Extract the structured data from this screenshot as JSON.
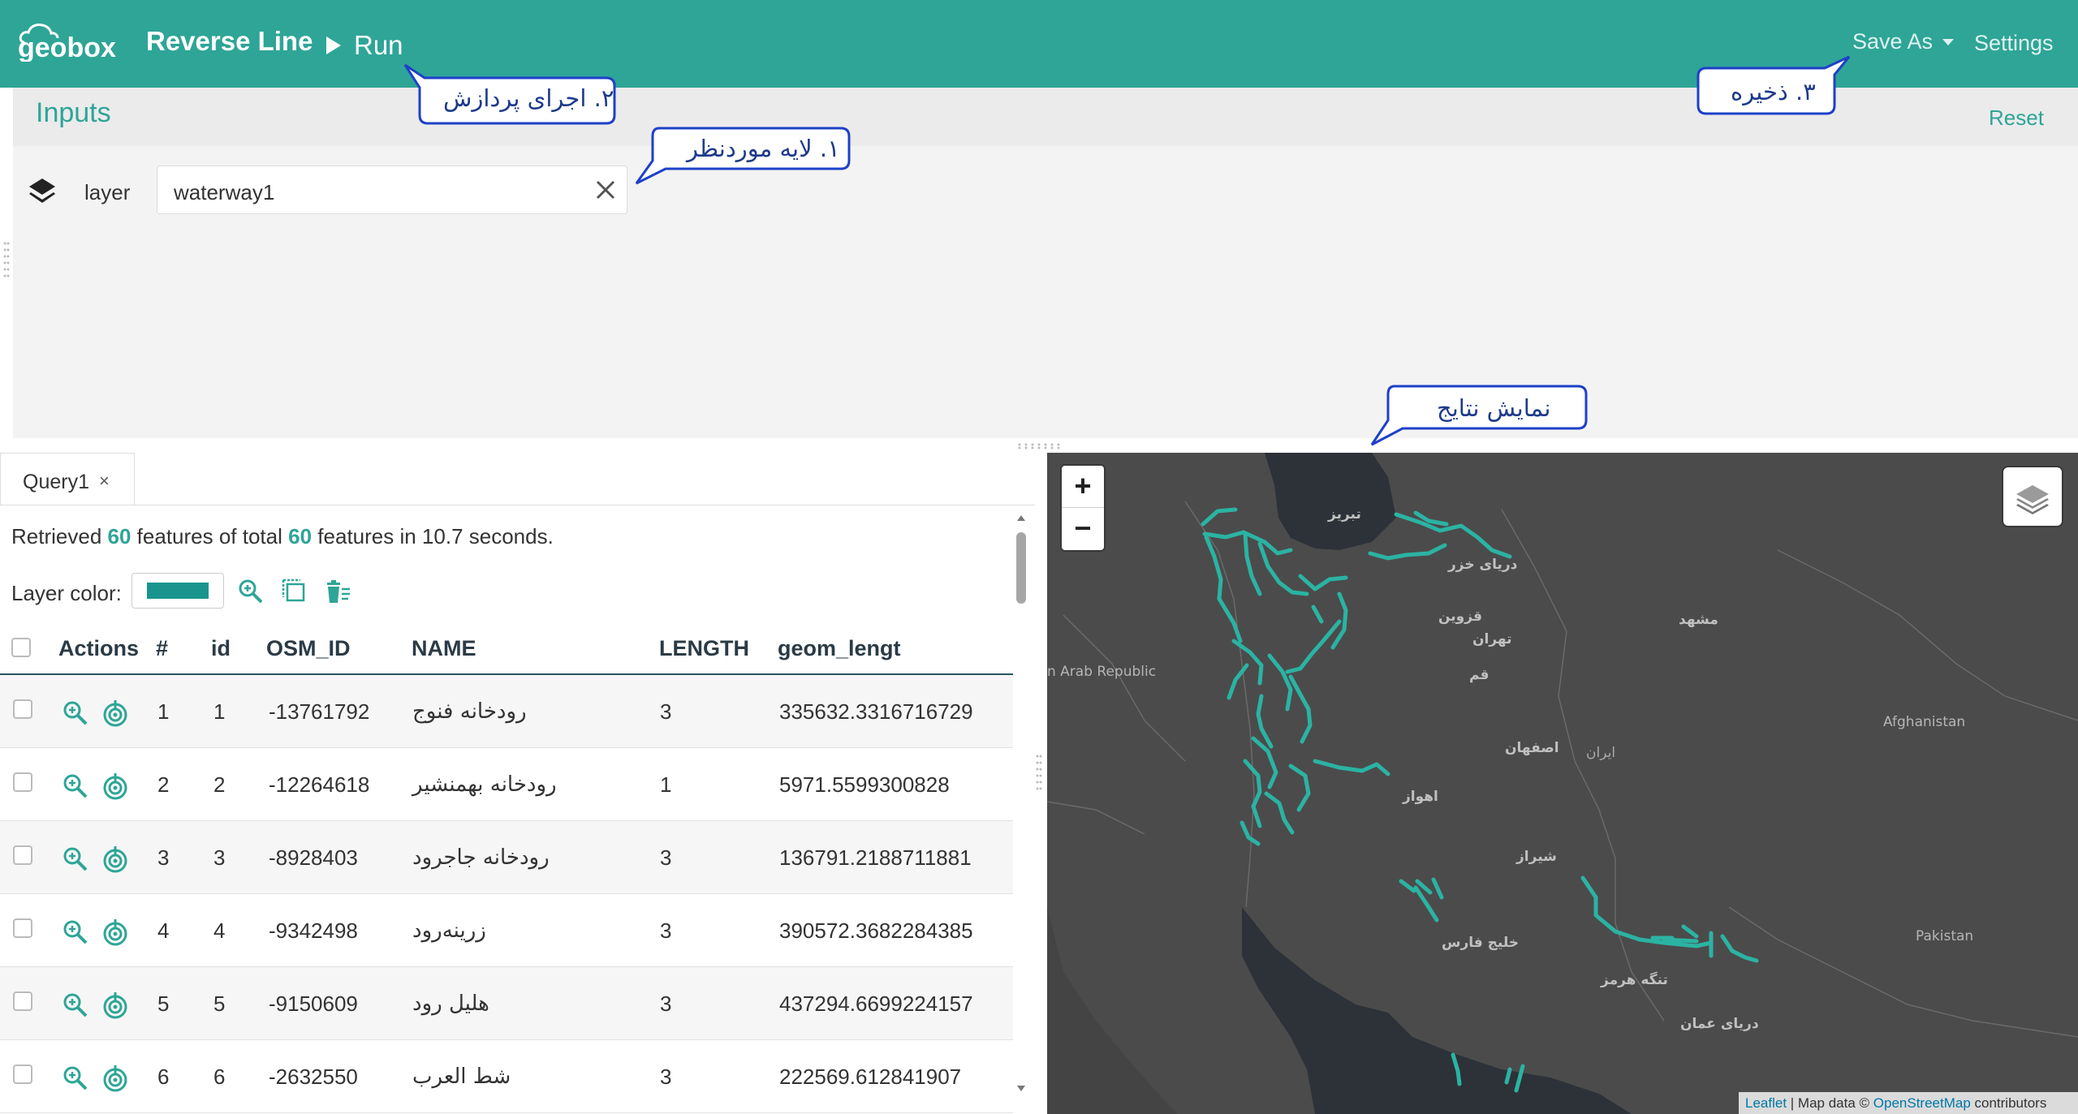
{
  "header": {
    "logo_text": "geobox",
    "title": "Reverse Line",
    "run_label": "Run",
    "save_as_label": "Save As",
    "settings_label": "Settings",
    "bg_color": "#2ea597"
  },
  "inputs": {
    "title": "Inputs",
    "reset_label": "Reset",
    "layer_label": "layer",
    "layer_value": "waterway1"
  },
  "callouts": {
    "run": "۲. اجرای پردازش",
    "layer": "۱. لایه موردنظر",
    "save": "۳. ذخیره",
    "results": "نمایش نتایج"
  },
  "query": {
    "tab_label": "Query1",
    "tab_close": "×",
    "summary": {
      "prefix": "Retrieved",
      "retrieved": "60",
      "middle": "features of total",
      "total": "60",
      "suffix": "features in 10.7 seconds."
    },
    "layer_color_label": "Layer color:",
    "layer_color": "#1a958d",
    "columns": [
      "Actions",
      "#",
      "id",
      "OSM_ID",
      "NAME",
      "LENGTH",
      "geom_lengt"
    ],
    "rows": [
      {
        "num": "1",
        "id": "1",
        "osm_id": "-13761792",
        "name": "رودخانه فنوج",
        "length": "3",
        "geom": "335632.3316716729"
      },
      {
        "num": "2",
        "id": "2",
        "osm_id": "-12264618",
        "name": "رودخانه بهمنشیر",
        "length": "1",
        "geom": "5971.5599300828"
      },
      {
        "num": "3",
        "id": "3",
        "osm_id": "-8928403",
        "name": "رودخانه جاجرود",
        "length": "3",
        "geom": "136791.2188711881"
      },
      {
        "num": "4",
        "id": "4",
        "osm_id": "-9342498",
        "name": "زرینه‌رود",
        "length": "3",
        "geom": "390572.3682284385"
      },
      {
        "num": "5",
        "id": "5",
        "osm_id": "-9150609",
        "name": "هلیل رود",
        "length": "3",
        "geom": "437294.6699224157"
      },
      {
        "num": "6",
        "id": "6",
        "osm_id": "-2632550",
        "name": "شط العرب",
        "length": "3",
        "geom": "222569.612841907"
      }
    ]
  },
  "map": {
    "zoom_in": "+",
    "zoom_out": "−",
    "labels": {
      "arab_republic": "n Arab Republic",
      "afghanistan": "Afghanistan",
      "pakistan": "Pakistan",
      "tabriz": "تبریز",
      "caspian": "دریای خزر",
      "qazvin": "قزوین",
      "tehran": "تهران",
      "qom": "قم",
      "mashhad": "مشهد",
      "isfahan": "اصفهان",
      "iran": "ایران",
      "ahvaz": "اهواز",
      "shiraz": "شیراز",
      "persian_gulf": "خلیج فارس",
      "hormuz": "تنگه هرمز",
      "oman_sea": "دریای عمان"
    },
    "attribution": {
      "leaflet": "Leaflet",
      "map_data": " | Map data © ",
      "osm": "OpenStreetMap",
      "contributors": " contributors"
    },
    "line_color": "#2bb3a3"
  }
}
